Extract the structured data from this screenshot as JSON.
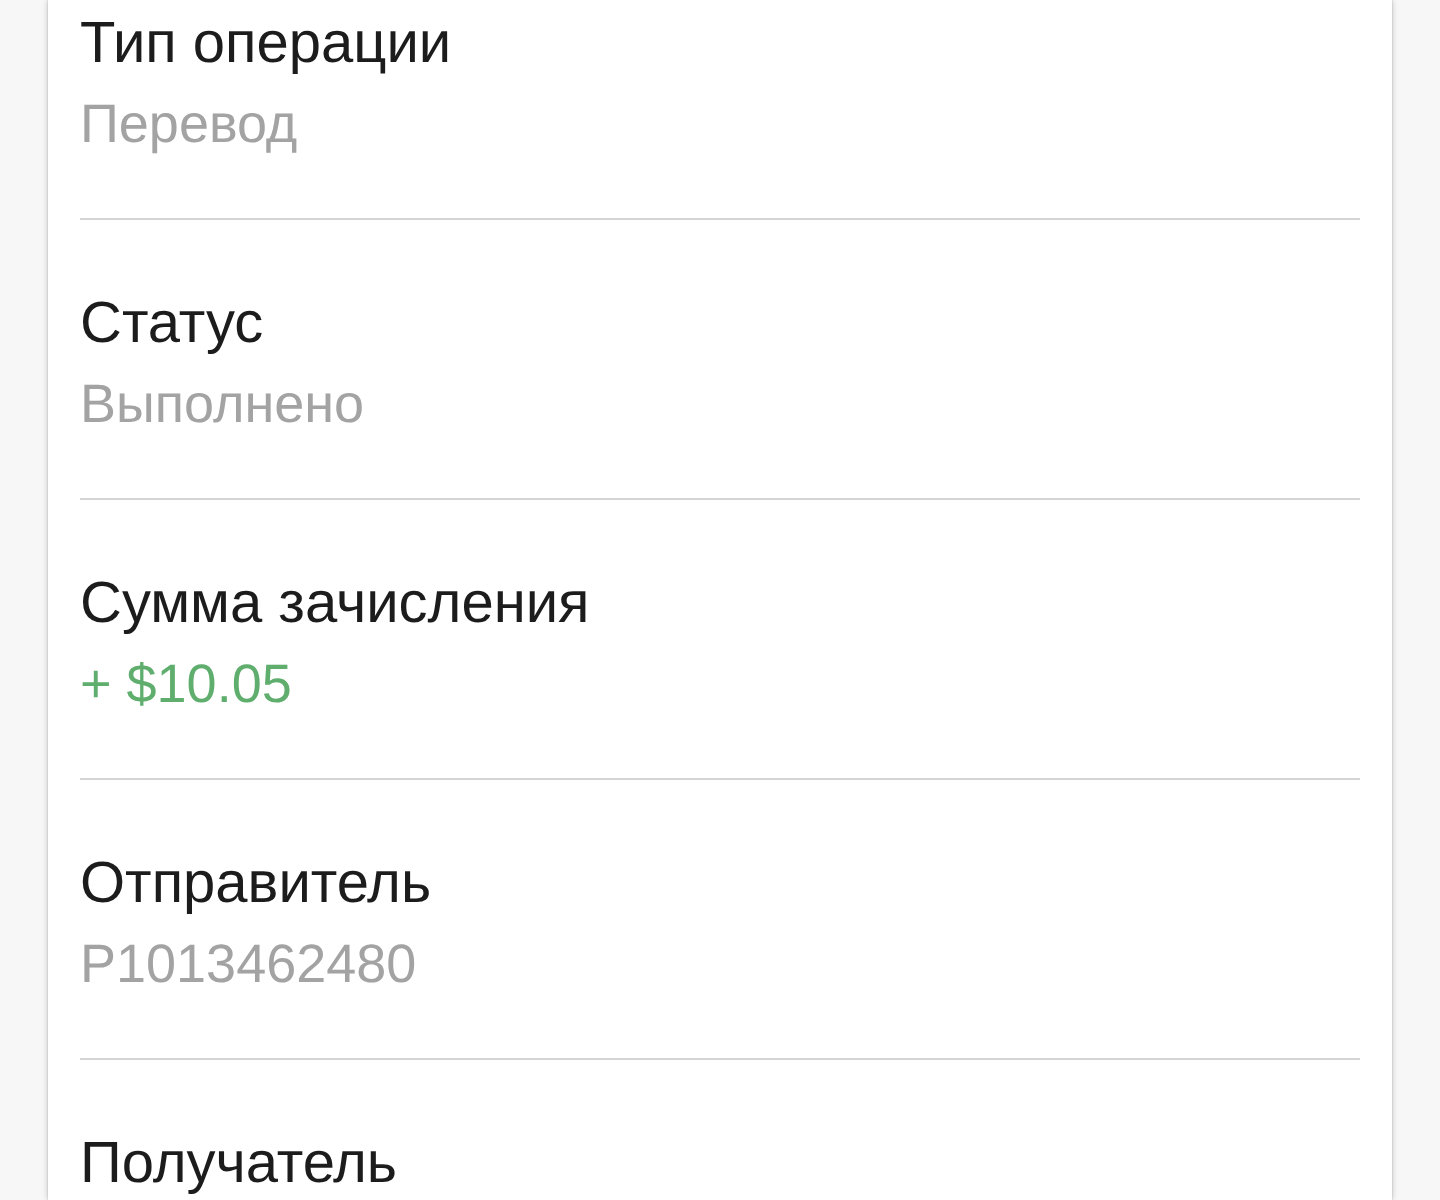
{
  "fields": [
    {
      "label": "Тип операции",
      "value": "Перевод",
      "kind": "text"
    },
    {
      "label": "Статус",
      "value": "Выполнено",
      "kind": "text"
    },
    {
      "label": "Сумма зачисления",
      "value": "+ $10.05",
      "kind": "credit"
    },
    {
      "label": "Отправитель",
      "value": "P1013462480",
      "kind": "text"
    },
    {
      "label": "Получатель"
    }
  ]
}
